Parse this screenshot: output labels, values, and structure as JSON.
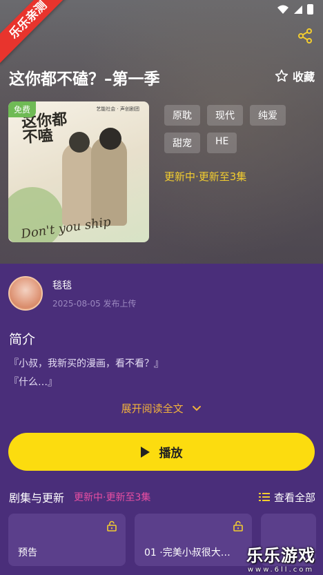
{
  "ribbon_text": "乐乐亲测",
  "header": {
    "title": "这你都不磕？–第一季",
    "collect_label": "收藏"
  },
  "cover": {
    "badge": "免费",
    "title_text": "这你都\n不嗑",
    "logo_text": "艺能社会 · 声创剧团",
    "script_text": "Don't you ship"
  },
  "tags": [
    "原耽",
    "现代",
    "纯爱",
    "甜宠",
    "HE"
  ],
  "update_status": "更新中·更新至3集",
  "author": {
    "name": "毯毯",
    "date": "2025-08-05 发布上传"
  },
  "intro": {
    "title": "简介",
    "line1": "『小叔，我新买的漫画，看不看？』",
    "line2": "『什么…』",
    "expand_label": "展开阅读全文"
  },
  "play_label": "播放",
  "episodes": {
    "title": "剧集与更新",
    "status": "更新中·更新至3集",
    "view_all": "查看全部",
    "items": [
      {
        "label": "预告"
      },
      {
        "label": "01 ·完美小叔很大…"
      },
      {
        "label": ""
      }
    ]
  },
  "watermark": {
    "text": "乐乐游戏",
    "url": "www.6ll.com"
  },
  "colors": {
    "background": "#4a2e7a",
    "accent_yellow": "#fcdc0f",
    "update_yellow": "#f3cd2f",
    "expand_orange": "#f2b23c",
    "status_pink": "#e84fa2",
    "ribbon_red": "#e8342d",
    "free_green": "#6fba55"
  }
}
